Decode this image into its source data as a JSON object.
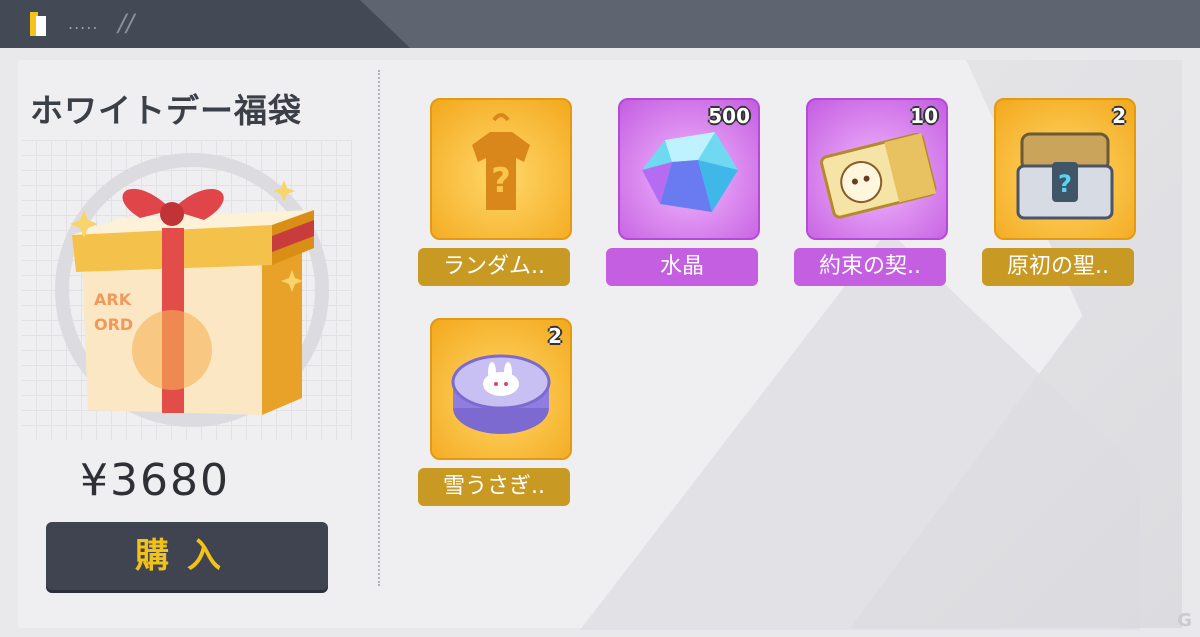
{
  "header": {
    "dots": ".....",
    "slash": "//"
  },
  "product": {
    "title": "ホワイトデー福袋",
    "price": "¥3680",
    "buy_label": "購入",
    "box_text": "ARK ORD"
  },
  "items": [
    {
      "label": "ランダム..",
      "qty": "",
      "rarity": "gold",
      "icon": "mystery-outfit-icon"
    },
    {
      "label": "水晶",
      "qty": "500",
      "rarity": "purple",
      "icon": "crystal-icon"
    },
    {
      "label": "約束の契..",
      "qty": "10",
      "rarity": "purple",
      "icon": "contract-ticket-icon"
    },
    {
      "label": "原初の聖..",
      "qty": "2",
      "rarity": "gold",
      "icon": "mystery-chest-icon"
    },
    {
      "label": "雪うさぎ..",
      "qty": "2",
      "rarity": "gold",
      "icon": "snow-rabbit-tin-icon"
    }
  ],
  "colors": {
    "gold": "#c99a23",
    "purple": "#c35fe0",
    "accent_yellow": "#f2c219"
  },
  "watermark": "G"
}
